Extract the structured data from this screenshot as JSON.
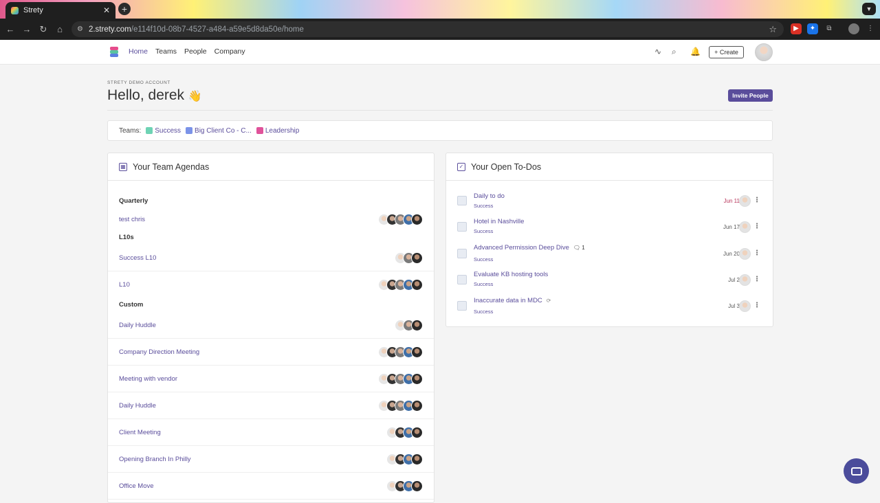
{
  "browser": {
    "tab_title": "Strety",
    "url_host": "2.strety.com",
    "url_path": "/e114f10d-08b7-4527-a484-a59e5d8da50e/home"
  },
  "nav": {
    "home": "Home",
    "teams": "Teams",
    "people": "People",
    "company": "Company",
    "create": "Create"
  },
  "greeting": {
    "account": "STRETY DEMO ACCOUNT",
    "hello": "Hello, derek",
    "emoji": "👋",
    "invite": "Invite People"
  },
  "teams_bar": {
    "label": "Teams:",
    "items": [
      {
        "name": "Success",
        "color": "#6ed3b4"
      },
      {
        "name": "Big Client Co - C...",
        "color": "#7b93e8"
      },
      {
        "name": "Leadership",
        "color": "#e0529a"
      }
    ]
  },
  "agendas": {
    "title": "Your Team Agendas",
    "sections": [
      {
        "name": "Quarterly",
        "rows": [
          {
            "label": "test chris",
            "avatars": 5
          }
        ]
      },
      {
        "name": "L10s",
        "rows": [
          {
            "label": "Success L10",
            "avatars": 3
          },
          {
            "label": "L10",
            "avatars": 5
          }
        ]
      },
      {
        "name": "Custom",
        "rows": [
          {
            "label": "Daily Huddle",
            "avatars": 3
          },
          {
            "label": "Company Direction Meeting",
            "avatars": 5
          },
          {
            "label": "Meeting with vendor",
            "avatars": 5
          },
          {
            "label": "Daily Huddle",
            "avatars": 5
          },
          {
            "label": "Client Meeting",
            "avatars": 4
          },
          {
            "label": "Opening Branch In Philly",
            "avatars": 4
          },
          {
            "label": "Office Move",
            "avatars": 4
          }
        ]
      }
    ]
  },
  "todos": {
    "title": "Your Open To-Dos",
    "items": [
      {
        "title": "Daily to do",
        "team": "Success",
        "date": "Jun 11",
        "late": true,
        "comments": ""
      },
      {
        "title": "Hotel in Nashville",
        "team": "Success",
        "date": "Jun 17",
        "late": false,
        "comments": ""
      },
      {
        "title": "Advanced Permission Deep Dive",
        "team": "Success",
        "date": "Jun 20",
        "late": false,
        "comments": "1"
      },
      {
        "title": "Evaluate KB hosting tools",
        "team": "Success",
        "date": "Jul 2",
        "late": false,
        "comments": ""
      },
      {
        "title": "Inaccurate data in MDC",
        "team": "Success",
        "date": "Jul 3",
        "late": false,
        "comments": ""
      }
    ]
  }
}
